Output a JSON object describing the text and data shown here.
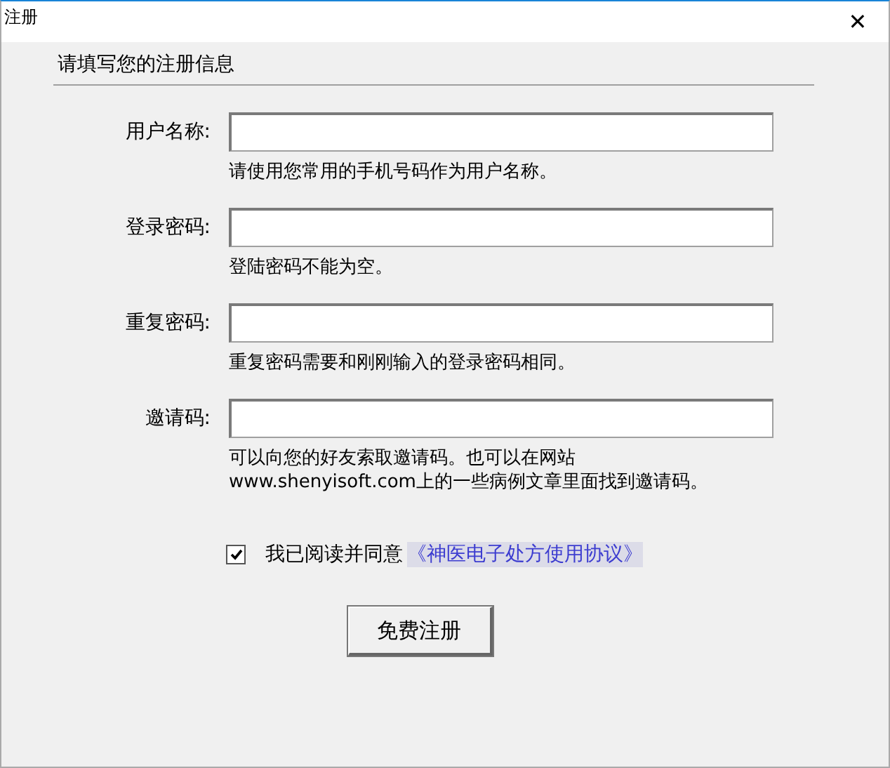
{
  "window": {
    "title": "注册",
    "close": "✕"
  },
  "heading": "请填写您的注册信息",
  "fields": [
    {
      "label": "用户名称:",
      "hint": [
        "请使用您常用的手机号码作为用户名称。"
      ]
    },
    {
      "label": "登录密码:",
      "hint": [
        "登陆密码不能为空。"
      ]
    },
    {
      "label": "重复密码:",
      "hint": [
        "重复密码需要和刚刚输入的登录密码相同。"
      ]
    },
    {
      "label": "邀请码:",
      "hint": [
        "可以向您的好友索取邀请码。也可以在网站",
        "www.shenyisoft.com上的一些病例文章里面找到邀请码。"
      ]
    }
  ],
  "agreement": {
    "checked": true,
    "label": "我已阅读并同意",
    "link": "《神医电子处方使用协议》"
  },
  "submit": "免费注册"
}
